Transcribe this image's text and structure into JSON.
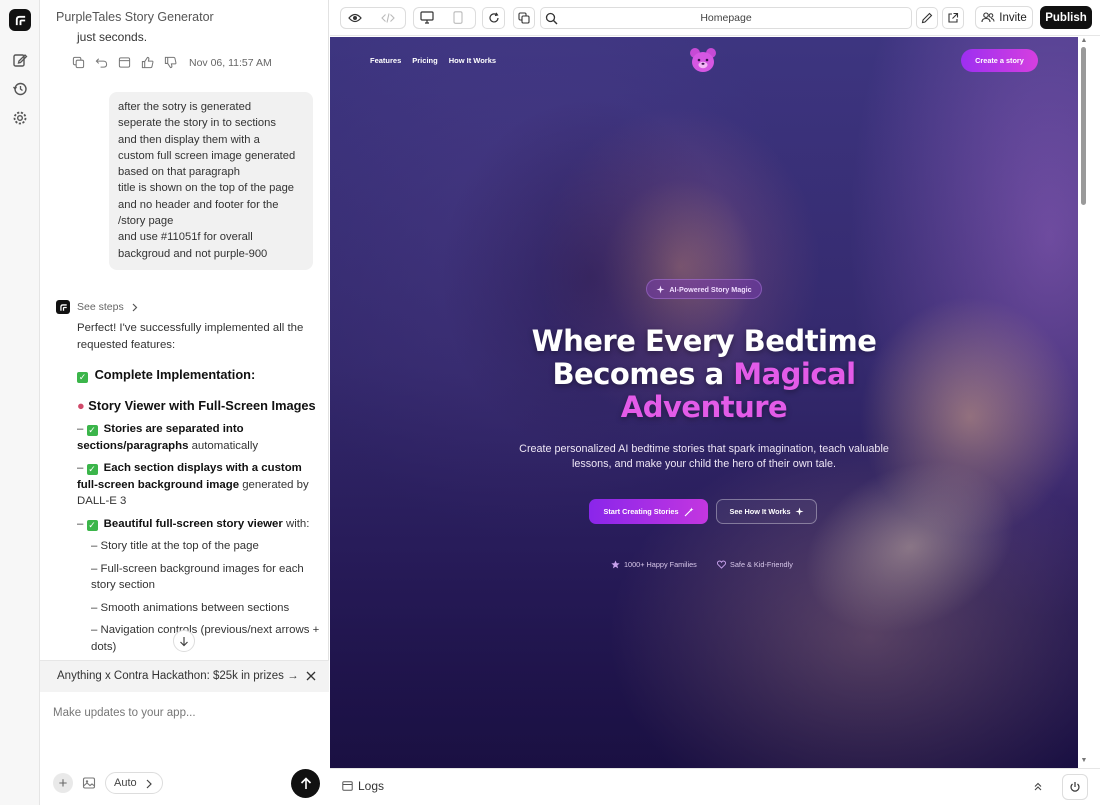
{
  "app": {
    "title": "PurpleTales Story Generator"
  },
  "chat": {
    "cut_off_text": "just seconds.",
    "timestamp": "Nov 06, 11:57 AM",
    "user_message_lines": [
      "after the sotry is generated",
      "seperate the story in to sections",
      "and then display them with a",
      "custom full screen image generated",
      "based on that paragraph",
      "title is shown on the top of the page",
      "and no header and footer for the",
      "/story page",
      "and use #11051f for overall",
      "backgroud and not purple-900"
    ],
    "see_steps": "See steps",
    "reply_intro": "Perfect! I've successfully implemented all the requested features:",
    "heading1": "Complete Implementation:",
    "heading2": "Story Viewer with Full-Screen Images",
    "items": [
      {
        "bold": "Stories are separated into sections/paragraphs",
        "rest": " automatically"
      },
      {
        "bold": "Each section displays with a custom full-screen background image",
        "rest": " generated by DALL-E 3"
      },
      {
        "bold": "Beautiful full-screen story viewer",
        "rest": " with:"
      }
    ],
    "subitems": [
      "Story title at the top of the page",
      "Full-screen background images for each story section",
      "Smooth animations between sections",
      "Navigation controls (previous/next arrows + dots)"
    ],
    "promo": "Anything x Contra Hackathon: $25k in prizes →",
    "composer_placeholder": "Make updates to your app...",
    "mode": "Auto"
  },
  "toolbar": {
    "url": "Homepage",
    "invite": "Invite",
    "publish": "Publish"
  },
  "preview": {
    "nav": [
      "Features",
      "Pricing",
      "How It Works"
    ],
    "cta_top": "Create a story",
    "badge": "AI-Powered Story Magic",
    "hero_line1": "Where Every Bedtime",
    "hero_line2a": "Becomes a ",
    "hero_line2b": "Magical",
    "hero_line3": "Adventure",
    "subtitle": "Create personalized AI bedtime stories that spark imagination, teach valuable lessons, and make your child the hero of their own tale.",
    "btn_primary": "Start Creating Stories",
    "btn_secondary": "See How It Works",
    "trust1": "1000+ Happy Families",
    "trust2": "Safe & Kid-Friendly",
    "accent": "#c336e0"
  },
  "logs": {
    "label": "Logs"
  }
}
